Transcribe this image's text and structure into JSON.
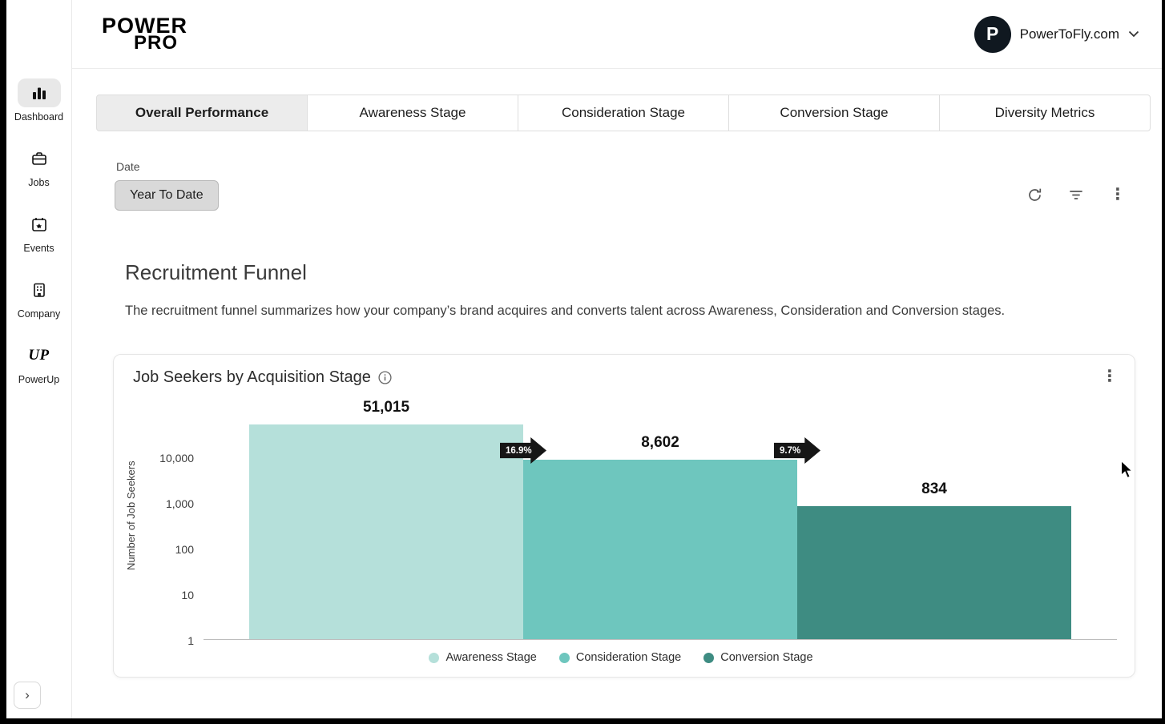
{
  "colors": {
    "accent_light": "#b5e0da",
    "accent_mid": "#6ec6be",
    "accent_dark": "#3e8c82"
  },
  "sidebar": {
    "items": [
      {
        "label": "Dashboard",
        "icon": "bar-chart-icon",
        "active": true
      },
      {
        "label": "Jobs",
        "icon": "briefcase-icon",
        "active": false
      },
      {
        "label": "Events",
        "icon": "calendar-star-icon",
        "active": false
      },
      {
        "label": "Company",
        "icon": "building-icon",
        "active": false
      },
      {
        "label": "PowerUp",
        "icon": "up-logo-icon",
        "active": false
      }
    ],
    "up_logo_text": "UP",
    "expand_label": "›"
  },
  "header": {
    "logo_line1": "POWER",
    "logo_line2": "PRO",
    "account": {
      "avatar_letter": "P",
      "label": "PowerToFly.com"
    }
  },
  "tabs": [
    {
      "label": "Overall Performance",
      "active": true
    },
    {
      "label": "Awareness Stage",
      "active": false
    },
    {
      "label": "Consideration Stage",
      "active": false
    },
    {
      "label": "Conversion Stage",
      "active": false
    },
    {
      "label": "Diversity Metrics",
      "active": false
    }
  ],
  "filters": {
    "date_label": "Date",
    "date_value": "Year To Date"
  },
  "section": {
    "title": "Recruitment Funnel",
    "description": "The recruitment funnel summarizes how your company’s brand acquires and converts talent across Awareness, Consideration and Conversion stages."
  },
  "chart_data": {
    "type": "bar",
    "title": "Job Seekers by Acquisition Stage",
    "categories": [
      "Awareness Stage",
      "Consideration Stage",
      "Conversion Stage"
    ],
    "values": [
      51015,
      8602,
      834
    ],
    "value_labels": [
      "51,015",
      "8,602",
      "834"
    ],
    "conversion_labels": [
      "16.9%",
      "9.7%"
    ],
    "ylabel": "Number of Job Seekers",
    "yscale": "log",
    "ylim": [
      1,
      100000
    ],
    "yticks": [
      "10,000",
      "1,000",
      "100",
      "10",
      "1"
    ],
    "colors": [
      "#b5e0da",
      "#6ec6be",
      "#3e8c82"
    ],
    "legend": [
      "Awareness Stage",
      "Consideration Stage",
      "Conversion Stage"
    ],
    "legend_position": "bottom",
    "grid": false
  }
}
